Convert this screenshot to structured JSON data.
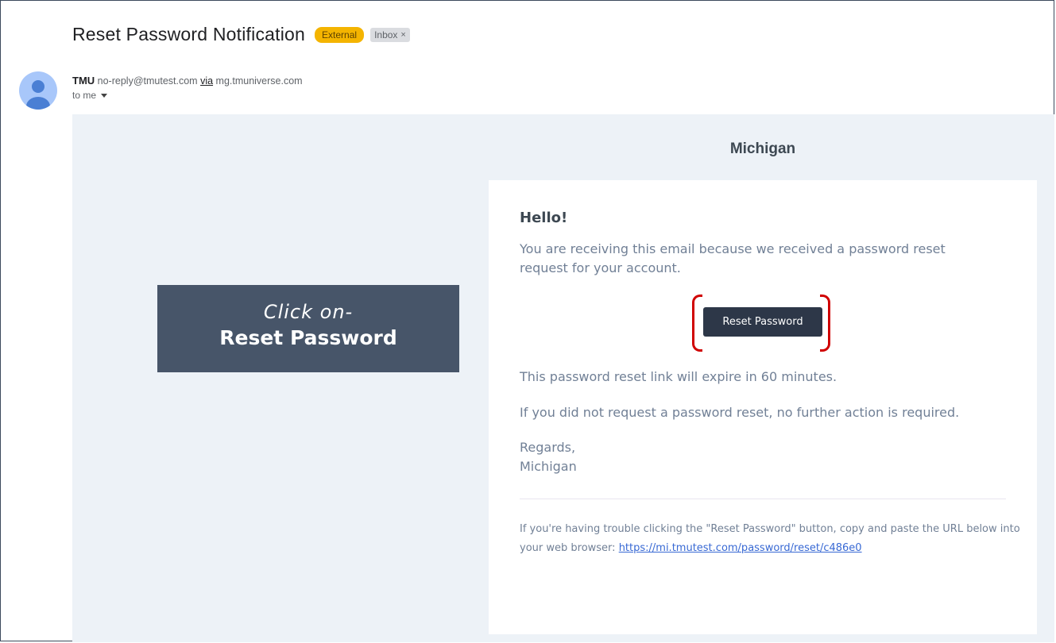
{
  "email": {
    "subject": "Reset Password Notification",
    "labels": {
      "external": "External",
      "inbox": "Inbox",
      "inbox_close": "×"
    },
    "sender": {
      "name": "TMU",
      "email": "no-reply@tmutest.com",
      "via_label": "via",
      "via_domain": "mg.tmuniverse.com"
    },
    "to_line": "to me"
  },
  "body": {
    "brand": "Michigan",
    "greeting": "Hello!",
    "intro": "You are receiving this email because we received a password reset request for your account.",
    "button_label": "Reset Password",
    "expire_note": "This password reset link will expire in 60 minutes.",
    "no_action": "If you did not request a password reset, no further action is required.",
    "regards": "Regards,",
    "signature": "Michigan",
    "trouble_text": "If you're having trouble clicking the \"Reset Password\" button, copy and paste the URL below into your web browser:",
    "reset_url": "https://mi.tmutest.com/password/reset/c486e0"
  },
  "callout": {
    "line1": "Click on-",
    "line2": "Reset Password"
  },
  "colors": {
    "accent_external": "#f4b400",
    "button": "#2d3748",
    "highlight": "#d00000",
    "callout_bg": "#475569",
    "body_bg": "#edf2f7"
  }
}
